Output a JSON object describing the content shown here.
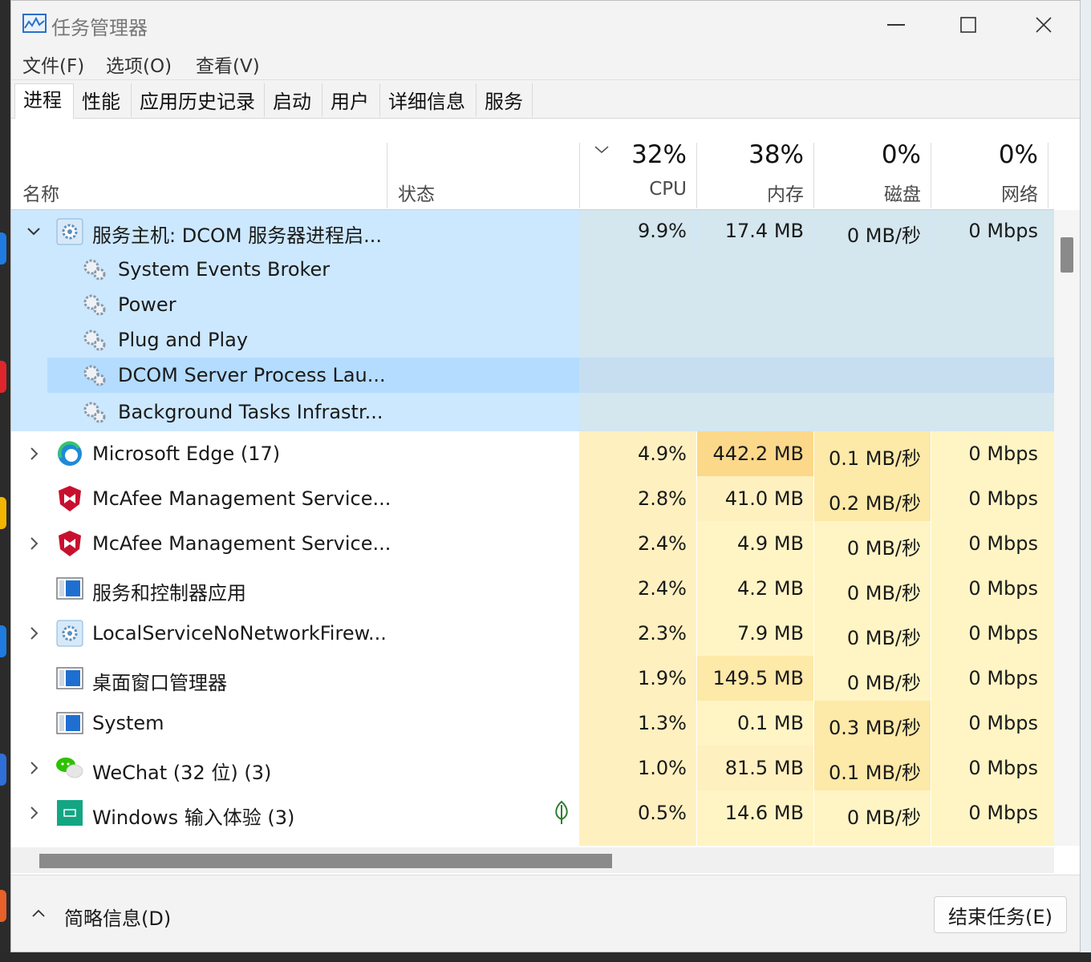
{
  "window": {
    "title": "任务管理器",
    "menu": [
      "文件(F)",
      "选项(O)",
      "查看(V)"
    ],
    "tabs": [
      "进程",
      "性能",
      "应用历史记录",
      "启动",
      "用户",
      "详细信息",
      "服务"
    ],
    "active_tab": "进程"
  },
  "columns": {
    "name": "名称",
    "status": "状态",
    "cpu": {
      "pct": "32%",
      "label": "CPU"
    },
    "mem": {
      "pct": "38%",
      "label": "内存"
    },
    "disk": {
      "pct": "0%",
      "label": "磁盘"
    },
    "net": {
      "pct": "0%",
      "label": "网络"
    }
  },
  "group": {
    "name": "服务主机: DCOM 服务器进程启...",
    "cpu": "9.9%",
    "mem": "17.4 MB",
    "disk": "0 MB/秒",
    "net": "0 Mbps",
    "children": [
      "System Events Broker",
      "Power",
      "Plug and Play",
      "DCOM Server Process Lau...",
      "Background Tasks Infrastr..."
    ]
  },
  "processes": [
    {
      "name": "Microsoft Edge (17)",
      "cpu": "4.9%",
      "mem": "442.2 MB",
      "disk": "0.1 MB/秒",
      "net": "0 Mbps",
      "icon": "edge-icon",
      "expandable": true
    },
    {
      "name": "McAfee Management Service...",
      "cpu": "2.8%",
      "mem": "41.0 MB",
      "disk": "0.2 MB/秒",
      "net": "0 Mbps",
      "icon": "mcafee-icon",
      "expandable": false
    },
    {
      "name": "McAfee Management Service...",
      "cpu": "2.4%",
      "mem": "4.9 MB",
      "disk": "0 MB/秒",
      "net": "0 Mbps",
      "icon": "mcafee-icon",
      "expandable": true
    },
    {
      "name": "服务和控制器应用",
      "cpu": "2.4%",
      "mem": "4.2 MB",
      "disk": "0 MB/秒",
      "net": "0 Mbps",
      "icon": "app-window-icon",
      "expandable": false
    },
    {
      "name": "LocalServiceNoNetworkFirew...",
      "cpu": "2.3%",
      "mem": "7.9 MB",
      "disk": "0 MB/秒",
      "net": "0 Mbps",
      "icon": "service-gear-icon",
      "expandable": true
    },
    {
      "name": "桌面窗口管理器",
      "cpu": "1.9%",
      "mem": "149.5 MB",
      "disk": "0 MB/秒",
      "net": "0 Mbps",
      "icon": "app-window-icon",
      "expandable": false
    },
    {
      "name": "System",
      "cpu": "1.3%",
      "mem": "0.1 MB",
      "disk": "0.3 MB/秒",
      "net": "0 Mbps",
      "icon": "app-window-icon",
      "expandable": false
    },
    {
      "name": "WeChat (32 位) (3)",
      "cpu": "1.0%",
      "mem": "81.5 MB",
      "disk": "0.1 MB/秒",
      "net": "0 Mbps",
      "icon": "wechat-icon",
      "expandable": true
    },
    {
      "name": "Windows 输入体验 (3)",
      "cpu": "0.5%",
      "mem": "14.6 MB",
      "disk": "0 MB/秒",
      "net": "0 Mbps",
      "icon": "keyboard-app-icon",
      "expandable": true,
      "status_icon": "leaf-icon"
    }
  ],
  "footer": {
    "fewer_details": "简略信息(D)",
    "end_task": "结束任务(E)"
  },
  "colors": {
    "selection": "#cce8ff",
    "selected_row": "#b4dcff",
    "heat_light": "#fff4c4",
    "heat_mid": "#fde9a8",
    "heat_strong": "#fcd88a"
  }
}
